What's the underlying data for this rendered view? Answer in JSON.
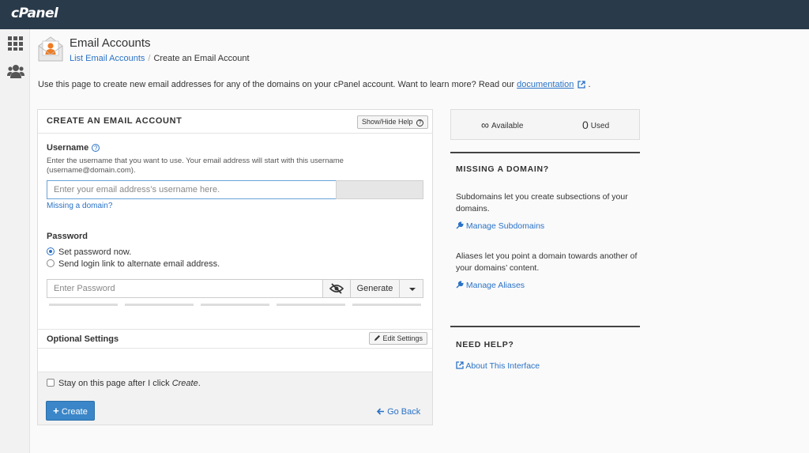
{
  "brand": {
    "logo": "cPanel"
  },
  "header": {
    "title": "Email Accounts",
    "breadcrumb": {
      "parent": "List Email Accounts",
      "current": "Create an Email Account"
    }
  },
  "intro": {
    "text": "Use this page to create new email addresses for any of the domains on your cPanel account. Want to learn more? Read our ",
    "link": "documentation",
    "after": "."
  },
  "form": {
    "title": "CREATE AN EMAIL ACCOUNT",
    "help_toggle": "Show/Hide Help",
    "username_label": "Username",
    "username_hint": "Enter the username that you want to use. Your email address will start with this username (username@domain.com).",
    "username_placeholder": "Enter your email address’s username here.",
    "missing_domain": "Missing a domain?",
    "password_label": "Password",
    "radio_set": "Set password now.",
    "radio_send": "Send login link to alternate email address.",
    "password_placeholder": "Enter Password",
    "generate": "Generate",
    "optional_label": "Optional Settings",
    "edit_settings": "Edit Settings",
    "stay_text": "Stay on this page after I click ",
    "stay_em": "Create",
    "stay_end": ".",
    "create": "Create",
    "go_back": "Go Back"
  },
  "stats": {
    "available_value": "∞",
    "available_label": "Available",
    "used_value": "0",
    "used_label": "Used"
  },
  "side": {
    "missing_title": "MISSING A DOMAIN?",
    "subdomains_text": "Subdomains let you create subsections of your domains.",
    "manage_subdomains": "Manage Subdomains",
    "aliases_text": "Aliases let you point a domain towards another of your domains’ content.",
    "manage_aliases": "Manage Aliases",
    "help_title": "NEED HELP?",
    "about": "About This Interface"
  },
  "icons": [
    "grid-icon",
    "users-icon",
    "envelope-user-icon",
    "external-link-icon",
    "help-icon",
    "eye-slash-icon",
    "caret-down-icon",
    "pencil-icon",
    "plus-icon",
    "arrow-left-icon",
    "wrench-icon"
  ],
  "colors": {
    "topbar": "#293a4a",
    "link": "#2a72c7",
    "primary": "#3a86c8"
  }
}
